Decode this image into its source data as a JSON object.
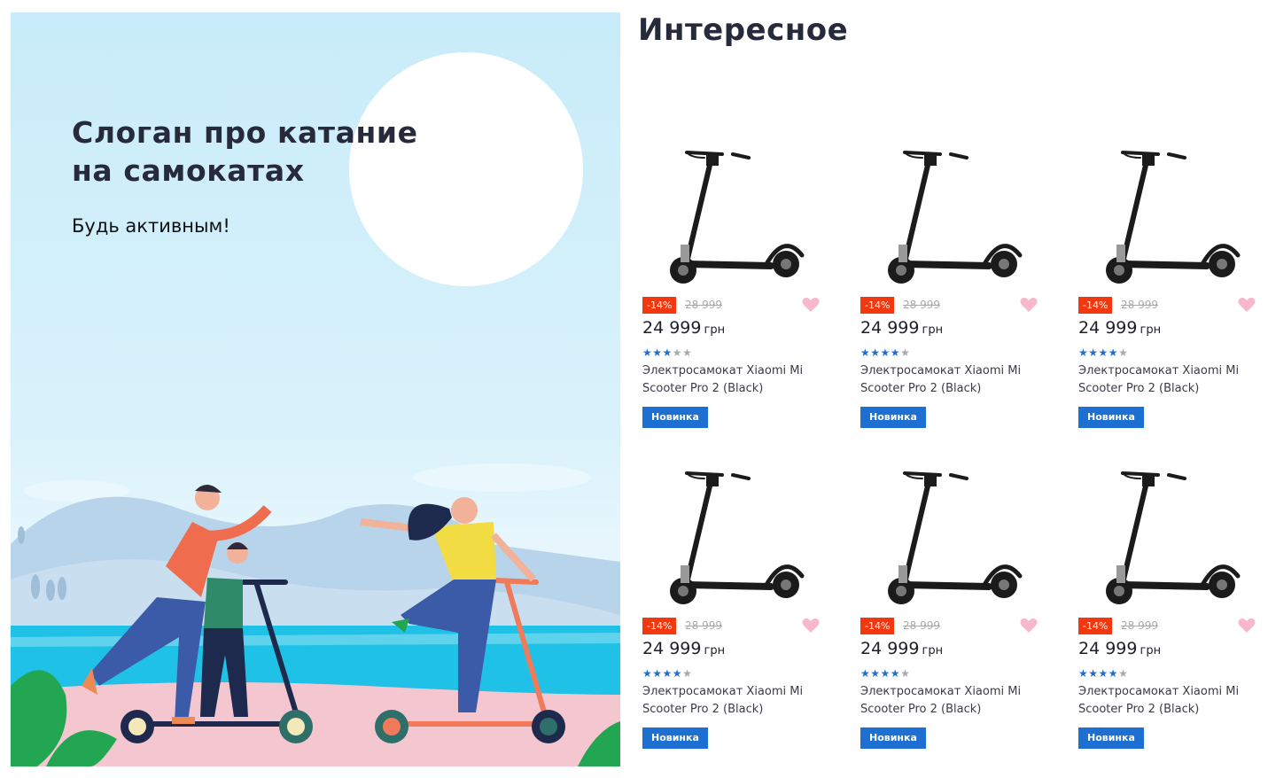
{
  "banner": {
    "title": "Слоган про катание\nна самокатах",
    "subtitle": "Будь активным!"
  },
  "section": {
    "title": "Интересное"
  },
  "colors": {
    "accent_blue": "#1d6fd1",
    "discount_red": "#f3380f",
    "heart_pink": "#f7b8cc",
    "star_gray": "#a9a9a9"
  },
  "products": [
    {
      "discount": "-14%",
      "old_price": "28 999",
      "price": "24 999",
      "currency": "грн",
      "rating": 3,
      "name": "Электросамокат Xiaomi Mi\nScooter Pro 2 (Black)",
      "badge": "Новинка",
      "icon": "heart-icon"
    },
    {
      "discount": "-14%",
      "old_price": "28 999",
      "price": "24 999",
      "currency": "грн",
      "rating": 4,
      "name": "Электросамокат Xiaomi Mi\nScooter Pro 2 (Black)",
      "badge": "Новинка",
      "icon": "heart-icon"
    },
    {
      "discount": "-14%",
      "old_price": "28 999",
      "price": "24 999",
      "currency": "грн",
      "rating": 4,
      "name": "Электросамокат Xiaomi Mi\nScooter Pro 2 (Black)",
      "badge": "Новинка",
      "icon": "heart-icon"
    },
    {
      "discount": "-14%",
      "old_price": "28 999",
      "price": "24 999",
      "currency": "грн",
      "rating": 4,
      "name": "Электросамокат Xiaomi Mi\nScooter Pro 2 (Black)",
      "badge": "Новинка",
      "icon": "heart-icon"
    },
    {
      "discount": "-14%",
      "old_price": "28 999",
      "price": "24 999",
      "currency": "грн",
      "rating": 4,
      "name": "Электросамокат Xiaomi Mi\nScooter Pro 2 (Black)",
      "badge": "Новинка",
      "icon": "heart-icon"
    },
    {
      "discount": "-14%",
      "old_price": "28 999",
      "price": "24 999",
      "currency": "грн",
      "rating": 4,
      "name": "Электросамокат Xiaomi Mi\nScooter Pro 2 (Black)",
      "badge": "Новинка",
      "icon": "heart-icon"
    }
  ]
}
